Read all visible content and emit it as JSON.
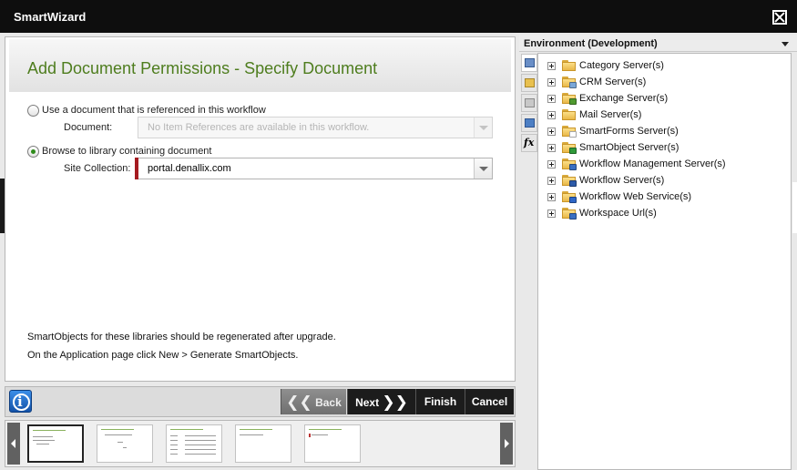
{
  "window": {
    "title": "SmartWizard"
  },
  "wizard": {
    "heading": "Add Document Permissions - Specify Document",
    "option_reference": {
      "label": "Use a document that is referenced in this workflow",
      "field_label": "Document:",
      "placeholder": "No Item References are available in this workflow.",
      "selected": false
    },
    "option_browse": {
      "label": "Browse to library containing document",
      "field_label": "Site Collection:",
      "value": "portal.denallix.com",
      "selected": true
    },
    "notes": [
      "SmartObjects for these libraries should be regenerated after upgrade.",
      "On the Application page click New > Generate SmartObjects."
    ]
  },
  "buttons": {
    "info": "i",
    "back": "Back",
    "next": "Next",
    "finish": "Finish",
    "cancel": "Cancel"
  },
  "environment": {
    "title": "Environment (Development)",
    "tree": [
      {
        "label": "Category Server(s)",
        "icon": "folder-icon",
        "overlay": "none"
      },
      {
        "label": "CRM Server(s)",
        "icon": "crm-folder-icon",
        "overlay": "#7aa7d8"
      },
      {
        "label": "Exchange Server(s)",
        "icon": "exchange-folder-icon",
        "overlay": "#4f9a2e"
      },
      {
        "label": "Mail Server(s)",
        "icon": "mail-folder-icon",
        "overlay": "none"
      },
      {
        "label": "SmartForms Server(s)",
        "icon": "smartforms-folder-icon",
        "overlay": "#ffffff"
      },
      {
        "label": "SmartObject Server(s)",
        "icon": "smartobject-folder-icon",
        "overlay": "#2f9a3a"
      },
      {
        "label": "Workflow Management Server(s)",
        "icon": "workflow-management-folder-icon",
        "overlay": "#3a6fc2"
      },
      {
        "label": "Workflow Server(s)",
        "icon": "workflow-folder-icon",
        "overlay": "#2d5aa8"
      },
      {
        "label": "Workflow Web Service(s)",
        "icon": "web-service-folder-icon",
        "overlay": "#2f66c6"
      },
      {
        "label": "Workspace Url(s)",
        "icon": "workspace-folder-icon",
        "overlay": "#3a6fc2"
      }
    ]
  }
}
